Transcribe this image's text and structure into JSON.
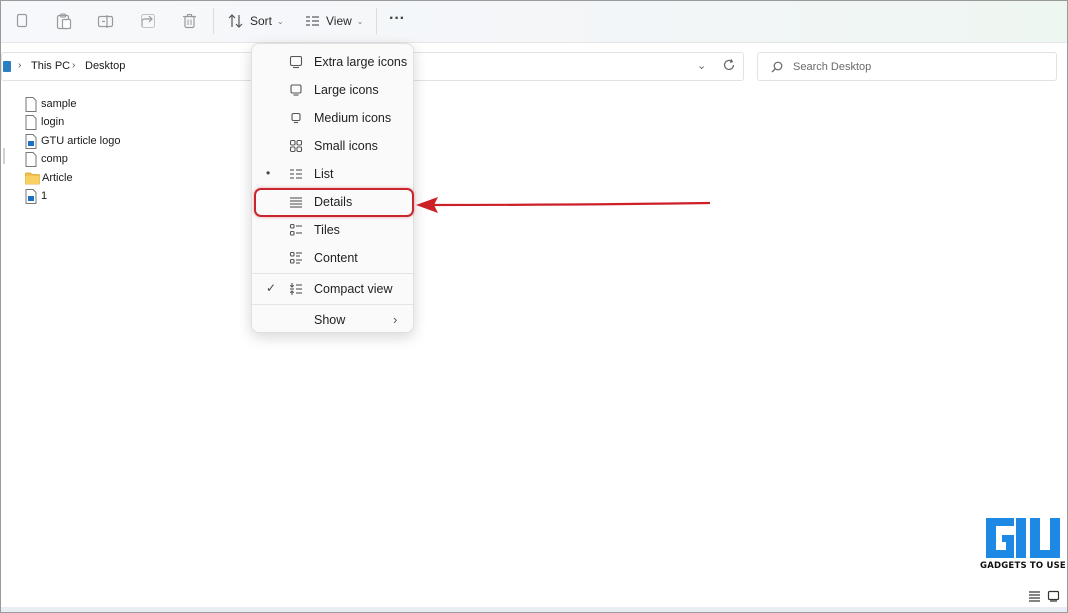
{
  "toolbar": {
    "sort_label": "Sort",
    "view_label": "View",
    "more_label": "···",
    "icons": [
      "copy-icon",
      "paste-icon",
      "rename-icon",
      "share-icon",
      "delete-icon",
      "sort-icon",
      "view-icon",
      "more-icon"
    ]
  },
  "address": {
    "crumbs": [
      "This PC",
      "Desktop"
    ],
    "search_placeholder": "Search Desktop"
  },
  "files": [
    {
      "name": "sample",
      "icon": "text-file-icon"
    },
    {
      "name": "login",
      "icon": "text-file-icon"
    },
    {
      "name": "GTU article logo",
      "icon": "image-file-icon"
    },
    {
      "name": "comp",
      "icon": "text-file-icon"
    },
    {
      "name": "Article",
      "icon": "folder-icon"
    },
    {
      "name": "1",
      "icon": "image-file-icon"
    }
  ],
  "view_menu": {
    "items": [
      {
        "label": "Extra large icons",
        "icon": "monitor-icon",
        "mark": ""
      },
      {
        "label": "Large icons",
        "icon": "monitor-icon",
        "mark": ""
      },
      {
        "label": "Medium icons",
        "icon": "monitor-icon",
        "mark": ""
      },
      {
        "label": "Small icons",
        "icon": "small-icons-icon",
        "mark": ""
      },
      {
        "label": "List",
        "icon": "list-icon",
        "mark": "•"
      },
      {
        "label": "Details",
        "icon": "details-icon",
        "mark": ""
      },
      {
        "label": "Tiles",
        "icon": "tiles-icon",
        "mark": ""
      },
      {
        "label": "Content",
        "icon": "content-icon",
        "mark": ""
      },
      {
        "label": "Compact view",
        "icon": "compact-icon",
        "mark": "✓"
      },
      {
        "label": "Show",
        "icon": "",
        "mark": "",
        "arrow": "›"
      }
    ]
  },
  "annotation": {
    "highlight_color": "#c8262c"
  },
  "watermark": {
    "logo_text": "GADGETS TO USE",
    "logo_color": "#1e88e5"
  }
}
